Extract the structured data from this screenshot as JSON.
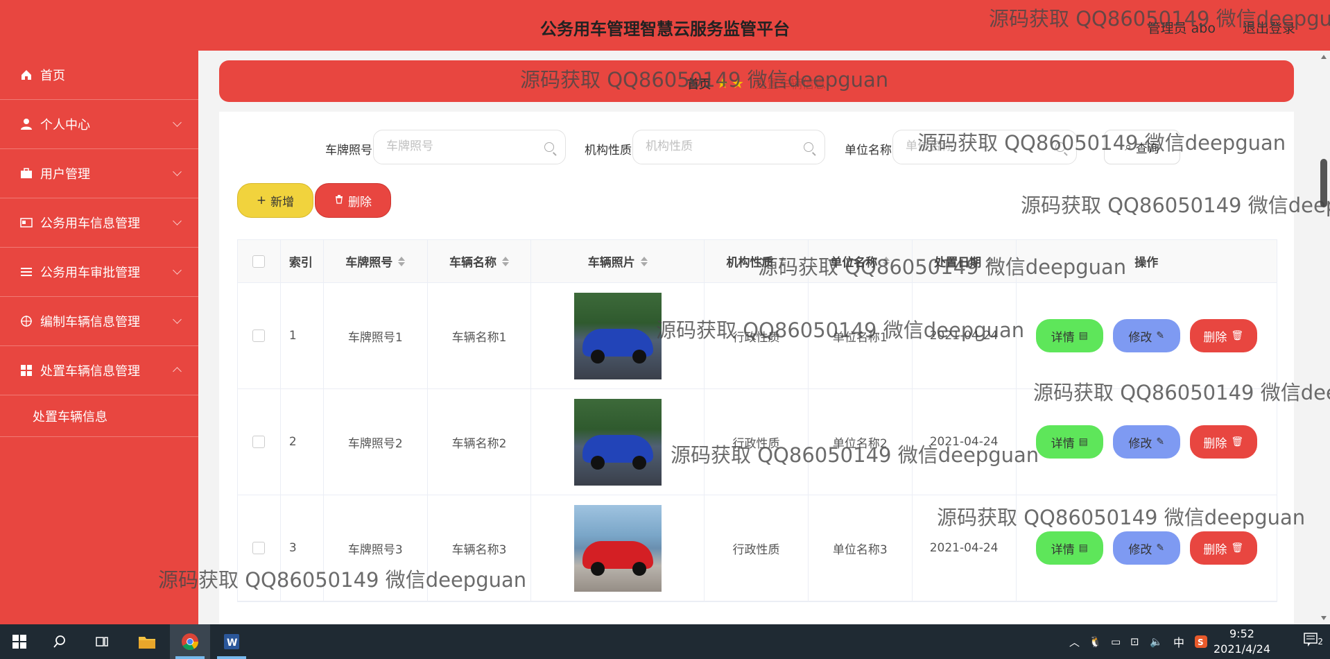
{
  "header": {
    "title": "公务用车管理智慧云服务监管平台",
    "user": "管理员 abo",
    "logout": "退出登录"
  },
  "sidebar": {
    "items": [
      {
        "label": "首页",
        "icon": "home-icon"
      },
      {
        "label": "个人中心",
        "icon": "person-icon"
      },
      {
        "label": "用户管理",
        "icon": "briefcase-icon"
      },
      {
        "label": "公务用车信息管理",
        "icon": "card-icon"
      },
      {
        "label": "公务用车审批管理",
        "icon": "list-icon"
      },
      {
        "label": "编制车辆信息管理",
        "icon": "target-icon"
      },
      {
        "label": "处置车辆信息管理",
        "icon": "grid-icon"
      }
    ],
    "subitem": "处置车辆信息"
  },
  "breadcrumb": {
    "home": "首页",
    "current": "处置车辆信息"
  },
  "search": {
    "plate_label": "车牌照号",
    "plate_placeholder": "车牌照号",
    "org_label": "机构性质",
    "org_placeholder": "机构性质",
    "unit_label": "单位名称",
    "unit_placeholder": "单位名称",
    "query": "查询"
  },
  "actions": {
    "add": "新增",
    "delete": "删除"
  },
  "table": {
    "headers": [
      "索引",
      "车牌照号",
      "车辆名称",
      "车辆照片",
      "机构性质",
      "单位名称",
      "处置日期",
      "操作"
    ],
    "rows": [
      {
        "index": "1",
        "plate": "车牌照号1",
        "name": "车辆名称1",
        "org": "行政性质",
        "unit": "单位名称1",
        "date": "2021-04-24"
      },
      {
        "index": "2",
        "plate": "车牌照号2",
        "name": "车辆名称2",
        "org": "行政性质",
        "unit": "单位名称2",
        "date": "2021-04-24"
      },
      {
        "index": "3",
        "plate": "车牌照号3",
        "name": "车辆名称3",
        "org": "行政性质",
        "unit": "单位名称3",
        "date": "2021-04-24"
      }
    ],
    "op_detail": "详情",
    "op_edit": "修改",
    "op_delete": "删除"
  },
  "watermark": "源码获取 QQ86050149 微信deepguan",
  "taskbar": {
    "time": "9:52",
    "date": "2021/4/24",
    "ime": "中",
    "notifications": "2"
  },
  "colors": {
    "primary": "#e84640",
    "add": "#f1d33d",
    "detail": "#5ee65a",
    "edit": "#7e9af2"
  }
}
